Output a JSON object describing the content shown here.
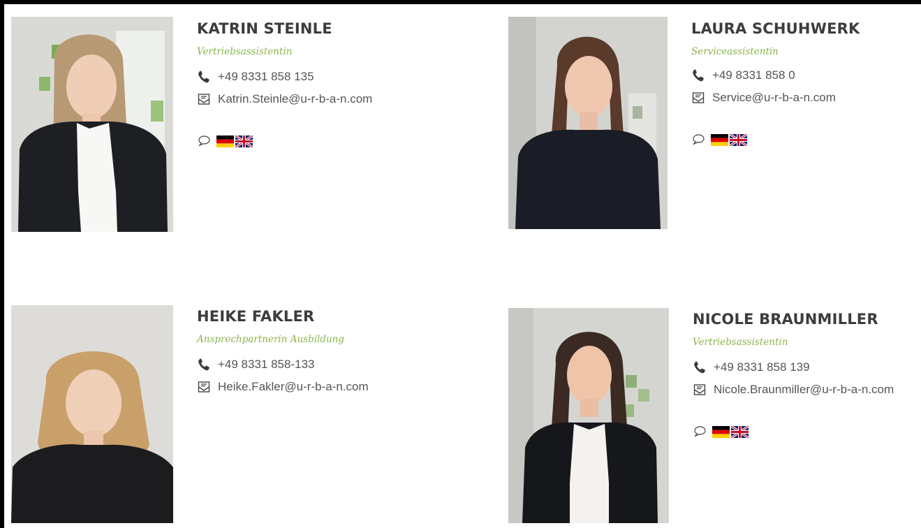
{
  "people": [
    {
      "name": "KATRIN STEINLE",
      "role": "Vertriebsassistentin",
      "phone": "+49 8331 858 135",
      "email": "Katrin.Steinle@u-r-b-a-n.com",
      "languages": [
        "german-flag",
        "uk-flag"
      ]
    },
    {
      "name": "LAURA SCHUHWERK",
      "role": "Serviceassistentin",
      "phone": "+49 8331 858 0",
      "email": "Service@u-r-b-a-n.com",
      "languages": [
        "german-flag",
        "uk-flag"
      ]
    },
    {
      "name": "HEIKE FAKLER",
      "role": "Ansprechpartnerin Ausbildung",
      "phone": "+49 8331 858-133",
      "email": "Heike.Fakler@u-r-b-a-n.com",
      "languages": []
    },
    {
      "name": "NICOLE BRAUNMILLER",
      "role": "Vertriebsassistentin",
      "phone": "+49 8331 858 139",
      "email": "Nicole.Braunmiller@u-r-b-a-n.com",
      "languages": [
        "german-flag",
        "uk-flag"
      ]
    }
  ],
  "icons": {
    "phone": "phone-icon",
    "email": "envelope-icon",
    "languages": "speech-bubble-icon"
  },
  "colors": {
    "role_text": "#8ab54e",
    "name_text": "#3c3c3c",
    "body_text": "#555555",
    "frame": "#000000"
  }
}
